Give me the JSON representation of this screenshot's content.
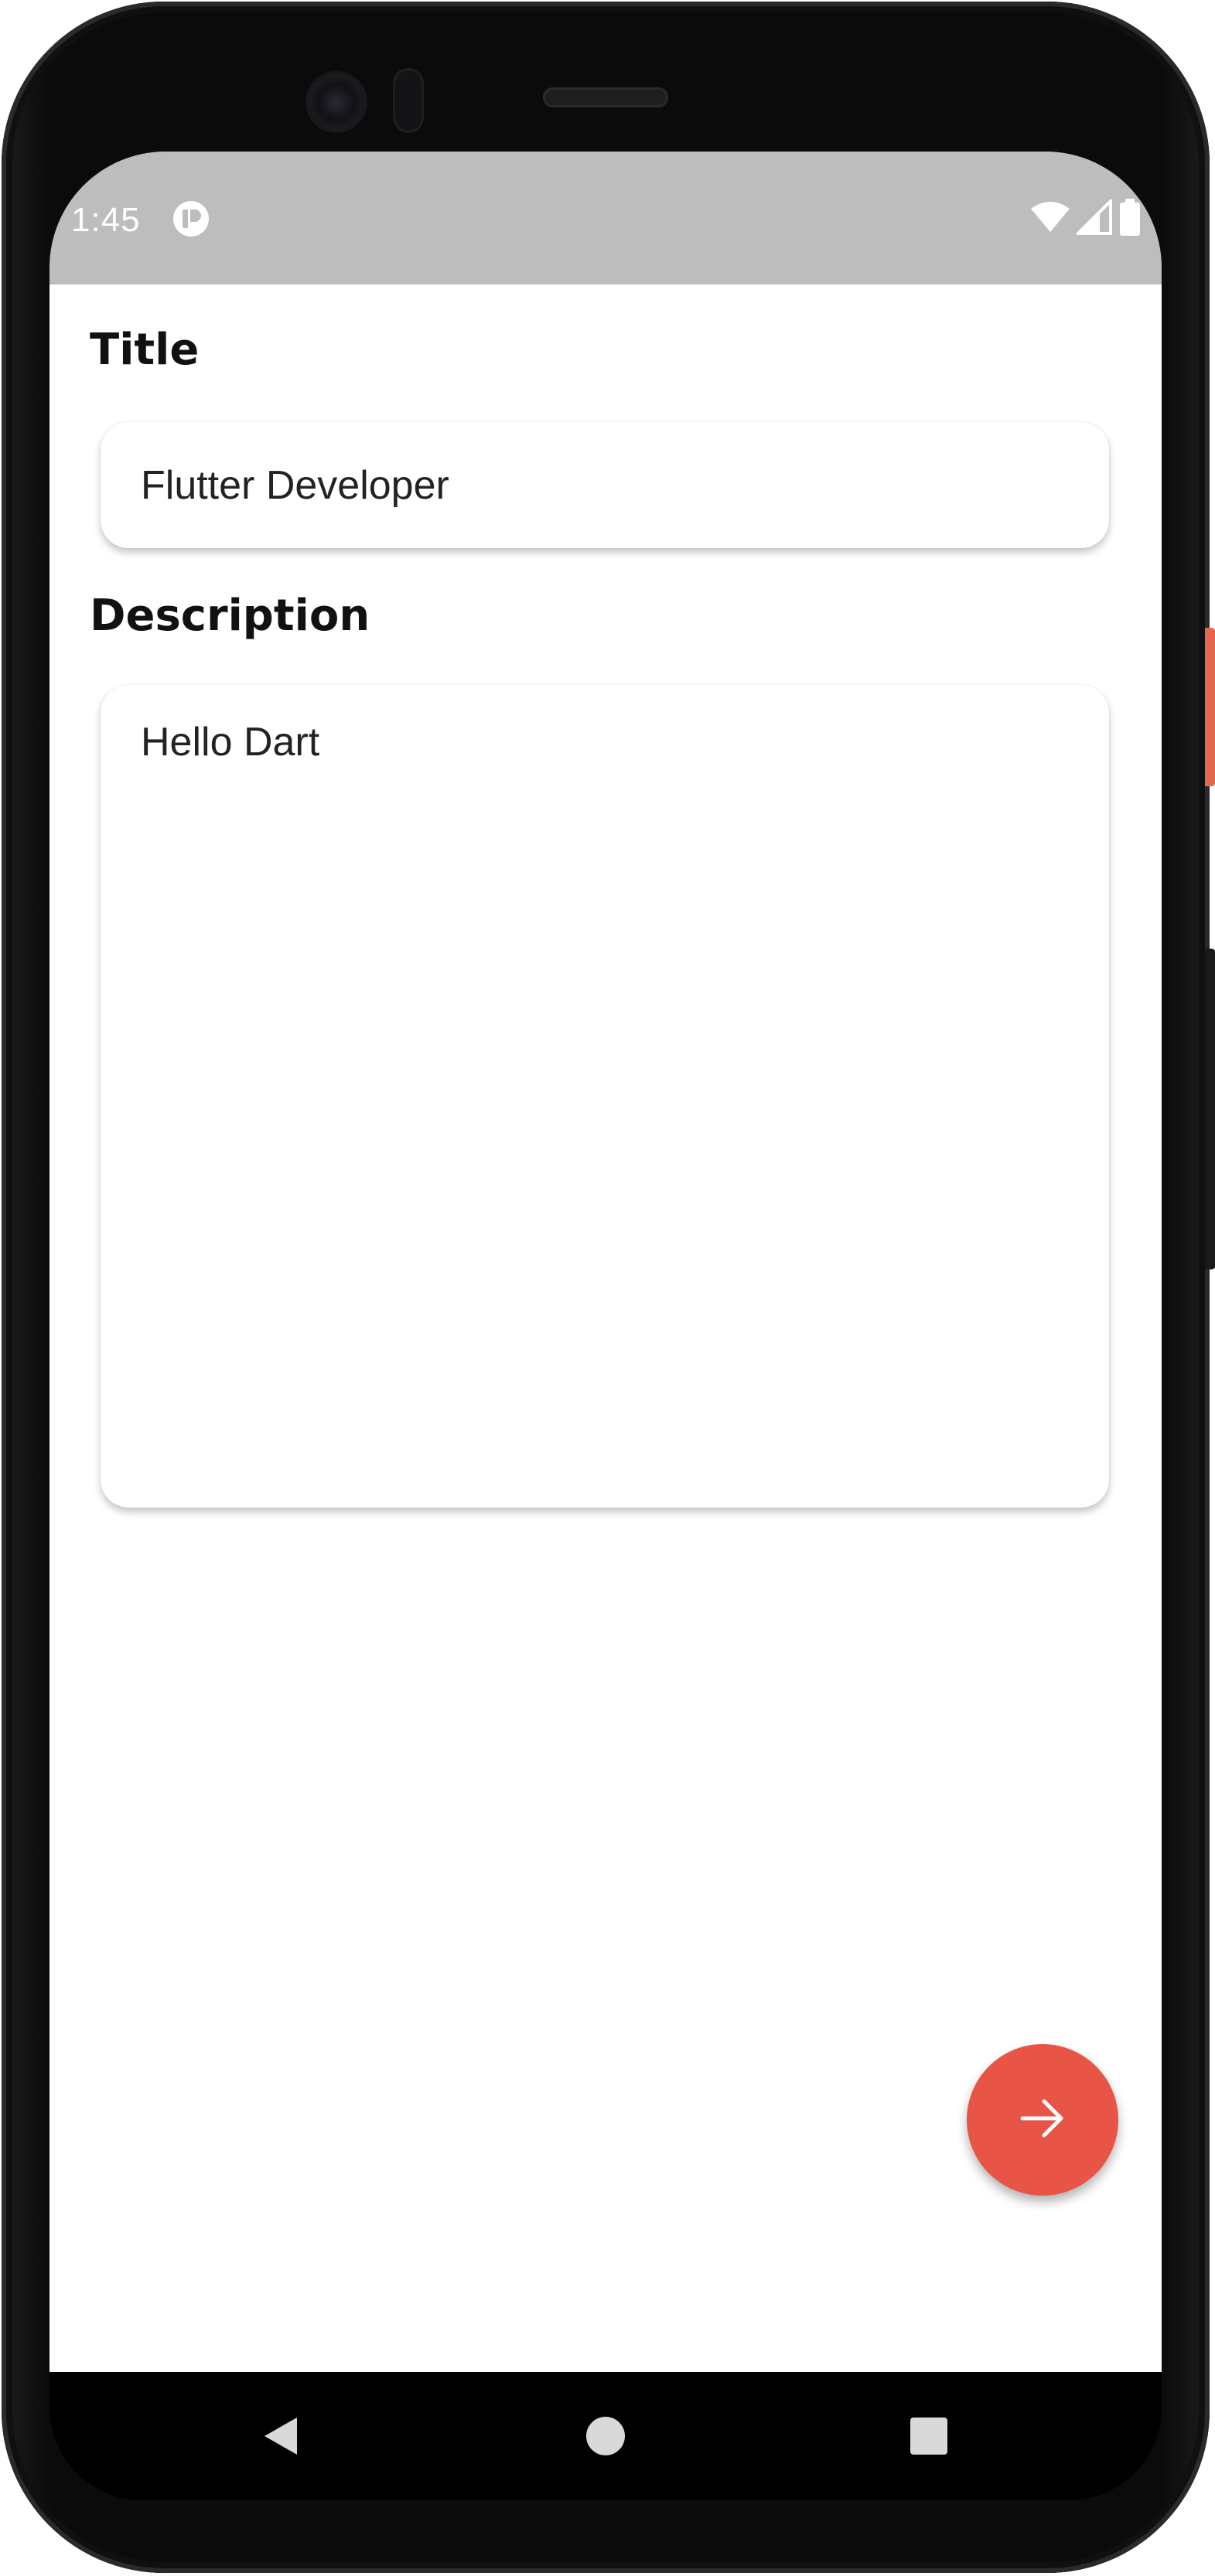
{
  "status_bar": {
    "time": "1:45",
    "icons": [
      "app-notification-icon",
      "wifi-icon",
      "cellular-signal-icon",
      "battery-icon"
    ]
  },
  "form": {
    "title_label": "Title",
    "title_value": "Flutter Developer",
    "description_label": "Description",
    "description_value": "Hello Dart"
  },
  "fab": {
    "icon": "arrow-right-icon",
    "color": "#e85446"
  },
  "nav_bar": {
    "buttons": [
      "back-icon",
      "home-icon",
      "recents-icon"
    ]
  },
  "colors": {
    "status_bar": "#bdbdbd",
    "accent": "#e85446",
    "background": "#ffffff"
  }
}
